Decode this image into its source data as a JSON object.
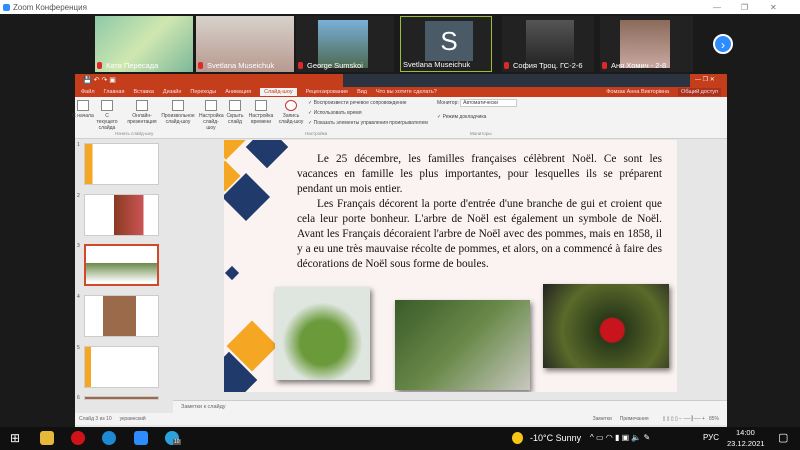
{
  "zoom": {
    "title": "Zoom Конференция",
    "participants": [
      {
        "name": "Катя Пересада",
        "muted": true
      },
      {
        "name": "Svetlana Museichuk",
        "muted": true
      },
      {
        "name": "George Sumskoi",
        "muted": true
      },
      {
        "name": "Svetlana Museichuk",
        "muted": false,
        "initial": "S"
      },
      {
        "name": "София Троц. ГС-2-6",
        "muted": true
      },
      {
        "name": "Аня Хомич - 2-8",
        "muted": true
      }
    ]
  },
  "ppt": {
    "user": "Фомзак Анна Викторівна",
    "share": "Общий доступ",
    "tabs": [
      "Файл",
      "Главная",
      "Вставка",
      "Дизайн",
      "Переходы",
      "Анимация",
      "Слайд-шоу",
      "Рецензирование",
      "Вид",
      "Что вы хотите сделать?"
    ],
    "ribbon": {
      "buttons": [
        "С начала",
        "С текущего слайда",
        "Онлайн-презентация",
        "Произвольное слайд-шоу",
        "Настройка слайд-шоу",
        "Скрыть слайд",
        "Настройка времени",
        "Запись слайд-шоу"
      ],
      "group1": "Начать слайд-шоу",
      "group2": "Настройка",
      "group3": "Мониторы",
      "checks": [
        "Воспроизвести речевое сопровождение",
        "Использовать время",
        "Показать элементы управления проигрывателем"
      ],
      "monitor_label": "Монитор:",
      "monitor_value": "Автоматически",
      "presenter": "Режим докладчика"
    },
    "slide_numbers": [
      "1",
      "2",
      "3",
      "4",
      "5",
      "6"
    ],
    "slide": {
      "p1": "Le 25 décembre, les familles françaises célèbrent Noël. Ce sont les vacances en famille les plus importantes, pour lesquelles ils se préparent pendant un mois entier.",
      "p2": "Les Français décorent la porte d'entrée d'une branche de gui et croient que cela leur porte bonheur. L'arbre de Noël est également un symbole de Noël. Avant les Français décoraient l'arbre de Noël avec des pommes, mais en 1858, il y a eu une très mauvaise récolte de pommes, et alors, on a commencé à faire des décorations de Noël sous forme de boules."
    },
    "notes": "Заметки к слайду",
    "status": {
      "slide": "Слайд 3 из 10",
      "lang": "украинский",
      "notes": "Заметки",
      "comments": "Примечания",
      "zoom": "85%"
    }
  },
  "taskbar": {
    "weather": "-10°C  Sunny",
    "lang": "РУС",
    "time": "14:00",
    "date": "23.12.2021",
    "telegram_badge": "10"
  }
}
